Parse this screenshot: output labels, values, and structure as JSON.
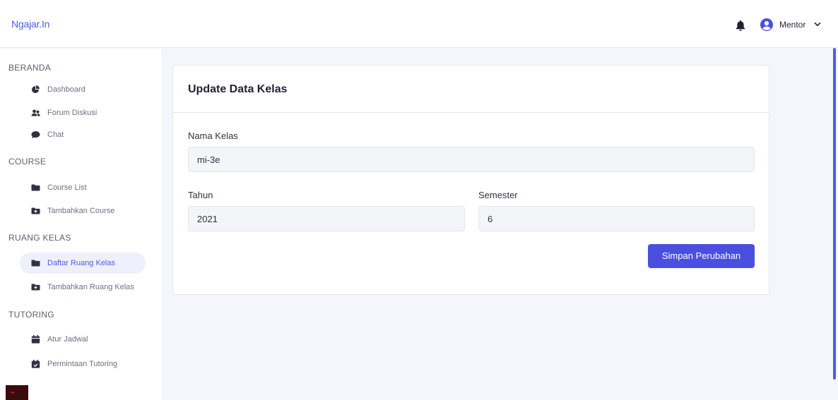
{
  "app": {
    "brand": "Ngajar.In"
  },
  "header": {
    "user_name": "Mentor"
  },
  "sidebar": {
    "sections": [
      {
        "title": "BERANDA"
      },
      {
        "title": "COURSE"
      },
      {
        "title": "RUANG KELAS"
      },
      {
        "title": "TUTORING"
      }
    ],
    "items": [
      {
        "label": "Dashboard",
        "icon": "chart-pie-icon"
      },
      {
        "label": "Forum Diskusi",
        "icon": "users-icon"
      },
      {
        "label": "Chat",
        "icon": "comment-icon"
      },
      {
        "label": "Course List",
        "icon": "folder-icon"
      },
      {
        "label": "Tambahkan Course",
        "icon": "folder-plus-icon"
      },
      {
        "label": "Daftar Ruang Kelas",
        "icon": "folder-icon"
      },
      {
        "label": "Tambahkan Ruang Kelas",
        "icon": "folder-plus-icon"
      },
      {
        "label": "Atur Jadwal",
        "icon": "calendar-icon"
      },
      {
        "label": "Permintaan Tutoring",
        "icon": "calendar-check-icon"
      }
    ]
  },
  "form": {
    "title": "Update Data Kelas",
    "nama_kelas_label": "Nama Kelas",
    "nama_kelas_value": "mi-3e",
    "tahun_label": "Tahun",
    "tahun_value": "2021",
    "semester_label": "Semester",
    "semester_value": "6",
    "submit_label": "Simpan Perubahan"
  },
  "colors": {
    "accent": "#4b4fe0",
    "brand": "#4e5ce6"
  }
}
